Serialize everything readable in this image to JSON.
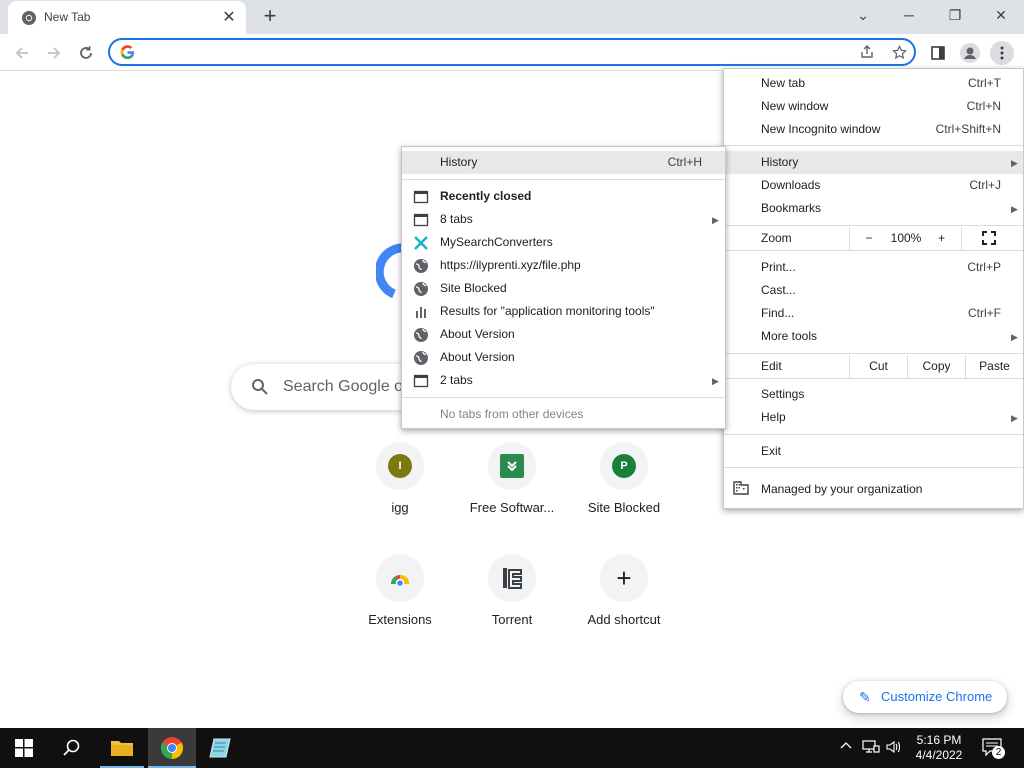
{
  "tab": {
    "title": "New Tab",
    "close": "✕"
  },
  "newtab": "+",
  "window": {
    "minimize": "─",
    "restore": "❐",
    "close": "✕",
    "tabsearch": "⌄"
  },
  "omnibox": {
    "value": "",
    "placeholder": ""
  },
  "search": {
    "placeholder": "Search Google o"
  },
  "shortcuts": [
    {
      "label": "igg",
      "letter": "I",
      "color": "#7a7a10"
    },
    {
      "label": "Free Softwar...",
      "letter": "»",
      "color": "#2d8a4e"
    },
    {
      "label": "Site Blocked",
      "letter": "P",
      "color": "#188038"
    },
    {
      "label": "Extensions",
      "letter": "",
      "color": ""
    },
    {
      "label": "Torrent",
      "letter": "",
      "color": ""
    },
    {
      "label": "Add shortcut",
      "letter": "+",
      "color": ""
    }
  ],
  "customize": {
    "label": "Customize Chrome"
  },
  "main_menu": {
    "new_tab": "New tab",
    "new_tab_sc": "Ctrl+T",
    "new_window": "New window",
    "new_window_sc": "Ctrl+N",
    "incognito": "New Incognito window",
    "incognito_sc": "Ctrl+Shift+N",
    "history": "History",
    "downloads": "Downloads",
    "downloads_sc": "Ctrl+J",
    "bookmarks": "Bookmarks",
    "zoom": "Zoom",
    "zoom_minus": "−",
    "zoom_value": "100%",
    "zoom_plus": "+",
    "print": "Print...",
    "print_sc": "Ctrl+P",
    "cast": "Cast...",
    "find": "Find...",
    "find_sc": "Ctrl+F",
    "more_tools": "More tools",
    "edit": "Edit",
    "cut": "Cut",
    "copy": "Copy",
    "paste": "Paste",
    "settings": "Settings",
    "help": "Help",
    "exit": "Exit",
    "managed": "Managed by your organization"
  },
  "history_menu": {
    "history": "History",
    "history_sc": "Ctrl+H",
    "recently_closed": "Recently closed",
    "items": [
      {
        "label": "8 tabs",
        "icon": "window-icon",
        "submenu": true
      },
      {
        "label": "MySearchConverters",
        "icon": "mysearch-icon"
      },
      {
        "label": "https://ilyprenti.xyz/file.php",
        "icon": "globe-icon"
      },
      {
        "label": "Site Blocked",
        "icon": "globe-icon"
      },
      {
        "label": "Results for \"application monitoring tools\"",
        "icon": "bars-icon"
      },
      {
        "label": "About Version",
        "icon": "globe-icon"
      },
      {
        "label": "About Version",
        "icon": "globe-icon"
      },
      {
        "label": "2 tabs",
        "icon": "window-icon",
        "submenu": true
      }
    ],
    "no_tabs": "No tabs from other devices"
  },
  "taskbar": {
    "time": "5:16 PM",
    "date": "4/4/2022",
    "notifications": "2"
  }
}
